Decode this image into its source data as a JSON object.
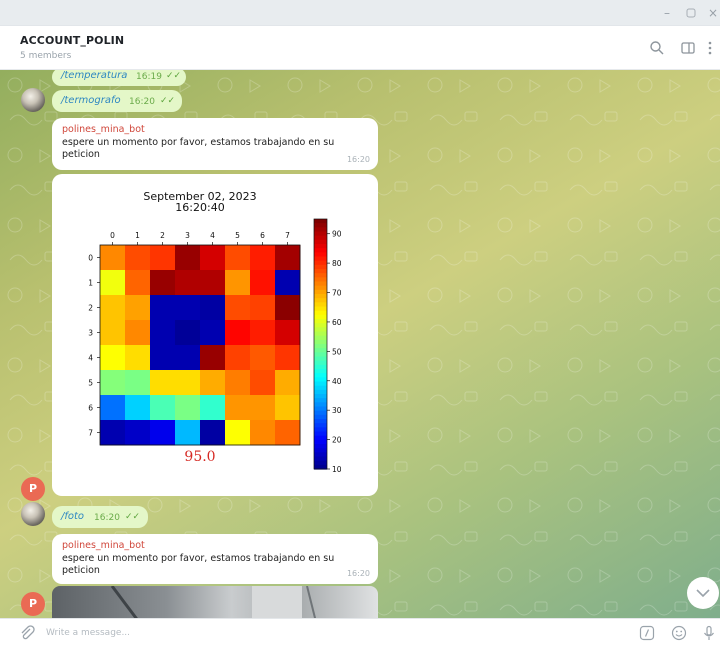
{
  "header": {
    "title": "ACCOUNT_POLIN",
    "subtitle": "5 members"
  },
  "messages": {
    "m1": {
      "text": "/temperatura",
      "time": "16:19"
    },
    "m2": {
      "text": "/termografo",
      "time": "16:20"
    },
    "m3": {
      "sender": "polines_mina_bot",
      "text": "espere un momento por favor, estamos trabajando en su peticion",
      "time": "16:20"
    },
    "m5": {
      "text": "/foto",
      "time": "16:20"
    },
    "m6": {
      "sender": "polines_mina_bot",
      "text": "espere un momento por favor, estamos trabajando en su peticion",
      "time": "16:20"
    }
  },
  "avatar_letter": "P",
  "composer": {
    "placeholder": "Write a message..."
  },
  "chart_data": {
    "type": "heatmap",
    "title": "September 02, 2023\n16:20:40",
    "x_ticks": [
      0,
      1,
      2,
      3,
      4,
      5,
      6,
      7
    ],
    "y_ticks": [
      0,
      1,
      2,
      3,
      4,
      5,
      6,
      7
    ],
    "annotation": "95.0",
    "colorbar": {
      "min": 10,
      "max": 95,
      "ticks": [
        10,
        20,
        30,
        40,
        50,
        60,
        70,
        80,
        90
      ]
    },
    "values": [
      [
        73,
        78,
        80,
        93,
        88,
        78,
        82,
        92
      ],
      [
        62,
        76,
        93,
        91,
        91,
        72,
        83,
        14
      ],
      [
        68,
        71,
        14,
        14,
        13,
        78,
        79,
        94
      ],
      [
        68,
        73,
        14,
        12,
        14,
        84,
        82,
        88
      ],
      [
        63,
        66,
        14,
        14,
        93,
        79,
        77,
        80
      ],
      [
        53,
        52,
        66,
        66,
        70,
        74,
        78,
        70
      ],
      [
        30,
        38,
        48,
        52,
        46,
        72,
        72,
        68
      ],
      [
        14,
        16,
        19,
        36,
        13,
        63,
        73,
        76
      ]
    ]
  },
  "colors": {
    "sender": "#d0473b",
    "command": "#2f88c2",
    "outgoing_bubble": "#e4f7c8"
  },
  "icons": [
    "search-icon",
    "sidebar-toggle-icon",
    "more-icon",
    "attach-icon",
    "commands-icon",
    "emoji-icon",
    "mic-icon",
    "chevron-down-icon",
    "double-check-icon"
  ]
}
